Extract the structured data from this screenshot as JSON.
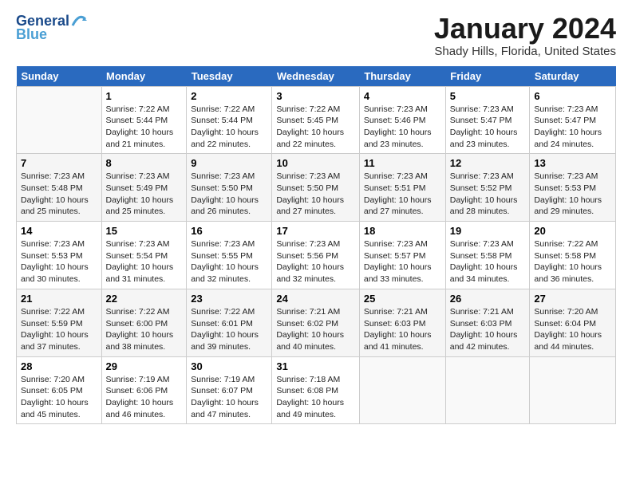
{
  "header": {
    "logo_line1": "General",
    "logo_line2": "Blue",
    "month": "January 2024",
    "location": "Shady Hills, Florida, United States"
  },
  "weekdays": [
    "Sunday",
    "Monday",
    "Tuesday",
    "Wednesday",
    "Thursday",
    "Friday",
    "Saturday"
  ],
  "weeks": [
    [
      {
        "day": "",
        "info": ""
      },
      {
        "day": "1",
        "info": "Sunrise: 7:22 AM\nSunset: 5:44 PM\nDaylight: 10 hours\nand 21 minutes."
      },
      {
        "day": "2",
        "info": "Sunrise: 7:22 AM\nSunset: 5:44 PM\nDaylight: 10 hours\nand 22 minutes."
      },
      {
        "day": "3",
        "info": "Sunrise: 7:22 AM\nSunset: 5:45 PM\nDaylight: 10 hours\nand 22 minutes."
      },
      {
        "day": "4",
        "info": "Sunrise: 7:23 AM\nSunset: 5:46 PM\nDaylight: 10 hours\nand 23 minutes."
      },
      {
        "day": "5",
        "info": "Sunrise: 7:23 AM\nSunset: 5:47 PM\nDaylight: 10 hours\nand 23 minutes."
      },
      {
        "day": "6",
        "info": "Sunrise: 7:23 AM\nSunset: 5:47 PM\nDaylight: 10 hours\nand 24 minutes."
      }
    ],
    [
      {
        "day": "7",
        "info": "Sunrise: 7:23 AM\nSunset: 5:48 PM\nDaylight: 10 hours\nand 25 minutes."
      },
      {
        "day": "8",
        "info": "Sunrise: 7:23 AM\nSunset: 5:49 PM\nDaylight: 10 hours\nand 25 minutes."
      },
      {
        "day": "9",
        "info": "Sunrise: 7:23 AM\nSunset: 5:50 PM\nDaylight: 10 hours\nand 26 minutes."
      },
      {
        "day": "10",
        "info": "Sunrise: 7:23 AM\nSunset: 5:50 PM\nDaylight: 10 hours\nand 27 minutes."
      },
      {
        "day": "11",
        "info": "Sunrise: 7:23 AM\nSunset: 5:51 PM\nDaylight: 10 hours\nand 27 minutes."
      },
      {
        "day": "12",
        "info": "Sunrise: 7:23 AM\nSunset: 5:52 PM\nDaylight: 10 hours\nand 28 minutes."
      },
      {
        "day": "13",
        "info": "Sunrise: 7:23 AM\nSunset: 5:53 PM\nDaylight: 10 hours\nand 29 minutes."
      }
    ],
    [
      {
        "day": "14",
        "info": "Sunrise: 7:23 AM\nSunset: 5:53 PM\nDaylight: 10 hours\nand 30 minutes."
      },
      {
        "day": "15",
        "info": "Sunrise: 7:23 AM\nSunset: 5:54 PM\nDaylight: 10 hours\nand 31 minutes."
      },
      {
        "day": "16",
        "info": "Sunrise: 7:23 AM\nSunset: 5:55 PM\nDaylight: 10 hours\nand 32 minutes."
      },
      {
        "day": "17",
        "info": "Sunrise: 7:23 AM\nSunset: 5:56 PM\nDaylight: 10 hours\nand 32 minutes."
      },
      {
        "day": "18",
        "info": "Sunrise: 7:23 AM\nSunset: 5:57 PM\nDaylight: 10 hours\nand 33 minutes."
      },
      {
        "day": "19",
        "info": "Sunrise: 7:23 AM\nSunset: 5:58 PM\nDaylight: 10 hours\nand 34 minutes."
      },
      {
        "day": "20",
        "info": "Sunrise: 7:22 AM\nSunset: 5:58 PM\nDaylight: 10 hours\nand 36 minutes."
      }
    ],
    [
      {
        "day": "21",
        "info": "Sunrise: 7:22 AM\nSunset: 5:59 PM\nDaylight: 10 hours\nand 37 minutes."
      },
      {
        "day": "22",
        "info": "Sunrise: 7:22 AM\nSunset: 6:00 PM\nDaylight: 10 hours\nand 38 minutes."
      },
      {
        "day": "23",
        "info": "Sunrise: 7:22 AM\nSunset: 6:01 PM\nDaylight: 10 hours\nand 39 minutes."
      },
      {
        "day": "24",
        "info": "Sunrise: 7:21 AM\nSunset: 6:02 PM\nDaylight: 10 hours\nand 40 minutes."
      },
      {
        "day": "25",
        "info": "Sunrise: 7:21 AM\nSunset: 6:03 PM\nDaylight: 10 hours\nand 41 minutes."
      },
      {
        "day": "26",
        "info": "Sunrise: 7:21 AM\nSunset: 6:03 PM\nDaylight: 10 hours\nand 42 minutes."
      },
      {
        "day": "27",
        "info": "Sunrise: 7:20 AM\nSunset: 6:04 PM\nDaylight: 10 hours\nand 44 minutes."
      }
    ],
    [
      {
        "day": "28",
        "info": "Sunrise: 7:20 AM\nSunset: 6:05 PM\nDaylight: 10 hours\nand 45 minutes."
      },
      {
        "day": "29",
        "info": "Sunrise: 7:19 AM\nSunset: 6:06 PM\nDaylight: 10 hours\nand 46 minutes."
      },
      {
        "day": "30",
        "info": "Sunrise: 7:19 AM\nSunset: 6:07 PM\nDaylight: 10 hours\nand 47 minutes."
      },
      {
        "day": "31",
        "info": "Sunrise: 7:18 AM\nSunset: 6:08 PM\nDaylight: 10 hours\nand 49 minutes."
      },
      {
        "day": "",
        "info": ""
      },
      {
        "day": "",
        "info": ""
      },
      {
        "day": "",
        "info": ""
      }
    ]
  ]
}
